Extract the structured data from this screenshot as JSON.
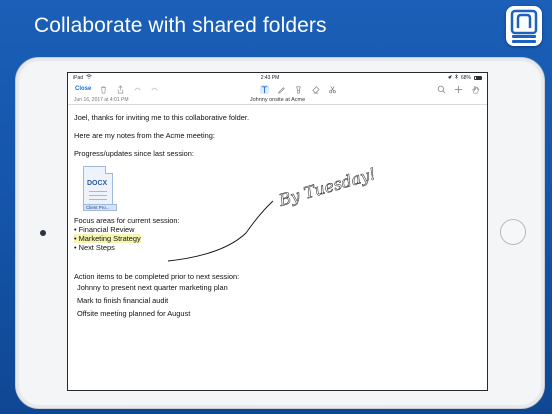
{
  "headline": "Collaborate with shared folders",
  "app_logo": {
    "icon": "notability-logo-icon",
    "color": "#1d63bd"
  },
  "status_bar": {
    "device": "iPad",
    "time": "2:43 PM",
    "battery": "68%"
  },
  "toolbar": {
    "close_label": "Close",
    "left_icons": [
      "trash-icon",
      "share-icon",
      "undo-icon",
      "redo-icon"
    ],
    "tools": [
      "text-tool-icon",
      "pen-tool-icon",
      "highlighter-tool-icon",
      "eraser-tool-icon",
      "scissors-tool-icon"
    ],
    "right_icons": [
      "search-icon",
      "add-icon",
      "hand-icon"
    ]
  },
  "meta": {
    "date": "Jun 16, 2017 at 4:01 PM",
    "title": "Johnny onsite at Acme"
  },
  "note": {
    "line1": "Joel, thanks for inviting me to this collaborative folder.",
    "line2": "Here are my notes from the Acme meeting:",
    "line3": "Progress/updates since last session:",
    "attachment": {
      "type_label": "DOCX",
      "caption": "Client Pro..."
    },
    "focus_header": "Focus areas for current session:",
    "focus_items": [
      "• Financial Review",
      "• Marketing Strategy",
      "• Next Steps"
    ],
    "action_header": "Action items to be completed prior to next session:",
    "action_items": [
      " Johnny to present next quarter marketing plan",
      " Mark to finish financial audit",
      " Offsite meeting planned for August"
    ],
    "handwriting": "By Tuesday!"
  }
}
